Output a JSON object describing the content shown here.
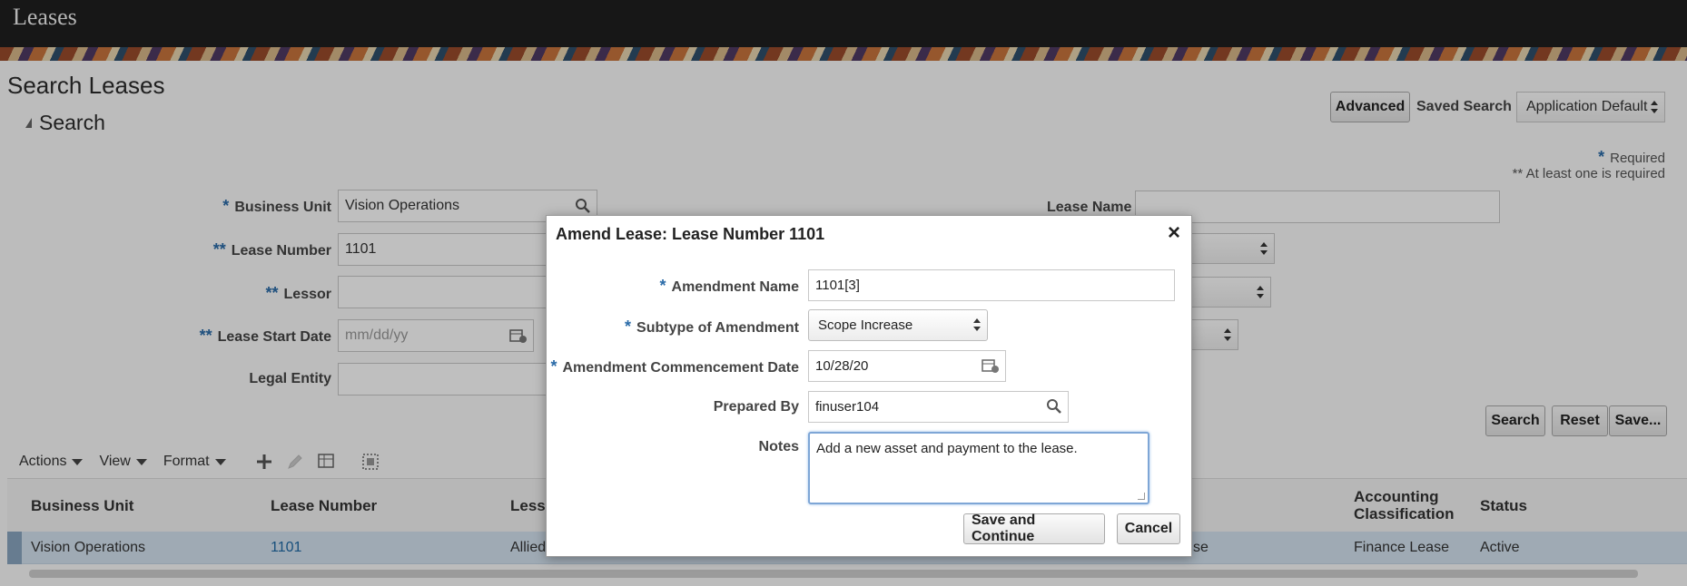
{
  "app": {
    "title": "Leases"
  },
  "page": {
    "title": "Search Leases"
  },
  "search": {
    "header": "Search",
    "advanced_label": "Advanced",
    "saved_search_label": "Saved Search",
    "saved_search_value": "Application Default",
    "required_note": "Required",
    "at_least_one_note": "** At least one is required",
    "fields": {
      "business_unit": {
        "label": "Business Unit",
        "value": "Vision Operations"
      },
      "lease_number": {
        "label": "Lease Number",
        "value": "1101"
      },
      "lessor": {
        "label": "Lessor",
        "value": ""
      },
      "lease_start_date": {
        "label": "Lease Start Date",
        "placeholder": "mm/dd/yy"
      },
      "legal_entity": {
        "label": "Legal Entity",
        "value": ""
      },
      "lease_name": {
        "label": "Lease Name",
        "value": ""
      }
    },
    "buttons": {
      "search": "Search",
      "reset": "Reset",
      "save": "Save..."
    }
  },
  "toolbar": {
    "actions": "Actions",
    "view": "View",
    "format": "Format"
  },
  "table": {
    "columns": [
      "Business Unit",
      "Lease Number",
      "Less",
      "Accounting Classification",
      "Status"
    ],
    "accounting_line1": "Accounting",
    "accounting_line2": "Classification",
    "row": {
      "business_unit": "Vision Operations",
      "lease_number": "1101",
      "lessor_partial": "Allied",
      "partial_col": "se",
      "accounting_classification": "Finance Lease",
      "status": "Active"
    }
  },
  "dialog": {
    "title": "Amend Lease: Lease Number 1101",
    "amendment_name": {
      "label": "Amendment Name",
      "value": "1101[3]"
    },
    "subtype": {
      "label": "Subtype of Amendment",
      "value": "Scope Increase"
    },
    "commencement_date": {
      "label": "Amendment Commencement Date",
      "value": "10/28/20"
    },
    "prepared_by": {
      "label": "Prepared By",
      "value": "finuser104"
    },
    "notes": {
      "label": "Notes",
      "value": "Add a new asset and payment to the lease."
    },
    "save_continue": "Save and Continue",
    "cancel": "Cancel"
  },
  "colors": {
    "accent": "#2a6ba8",
    "selected_row": "#d4e3f1",
    "focus_border": "#7ea6d6"
  }
}
